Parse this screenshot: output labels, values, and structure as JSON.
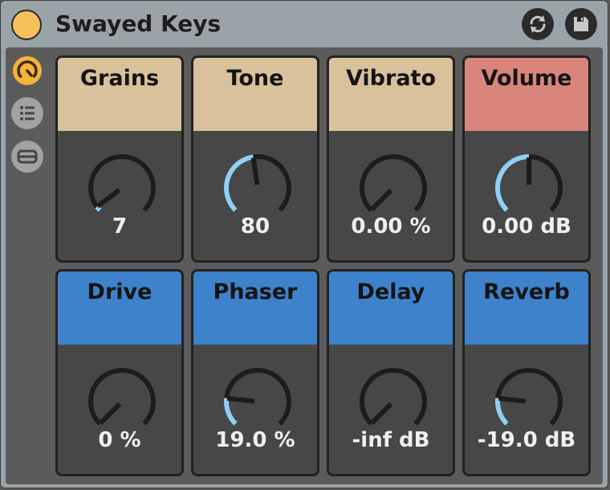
{
  "window": {
    "title": "Swayed Keys",
    "accent_color": "#f7c15a",
    "icons": {
      "power": "power-toggle-icon",
      "refresh": "refresh-icon",
      "save": "save-icon"
    }
  },
  "sidebar": {
    "items": [
      {
        "icon": "macro-knob-icon",
        "active": true
      },
      {
        "icon": "list-icon",
        "active": false
      },
      {
        "icon": "minimize-icon",
        "active": false
      }
    ]
  },
  "colors": {
    "beige": "#d9c19b",
    "red": "#d9857c",
    "blue": "#3d82cb",
    "arc_active": "#8fd0f5",
    "knob_track": "#1c1c1c"
  },
  "knobs": [
    {
      "label": "Grains",
      "value": "7",
      "fraction": 0.03,
      "color": "beige"
    },
    {
      "label": "Tone",
      "value": "80",
      "fraction": 0.47,
      "color": "beige"
    },
    {
      "label": "Vibrato",
      "value": "0.00 %",
      "fraction": 0.0,
      "color": "beige"
    },
    {
      "label": "Volume",
      "value": "0.00 dB",
      "fraction": 0.5,
      "color": "red"
    },
    {
      "label": "Drive",
      "value": "0 %",
      "fraction": 0.0,
      "color": "blue"
    },
    {
      "label": "Phaser",
      "value": "19.0 %",
      "fraction": 0.19,
      "color": "blue"
    },
    {
      "label": "Delay",
      "value": "-inf dB",
      "fraction": 0.0,
      "color": "blue"
    },
    {
      "label": "Reverb",
      "value": "-19.0 dB",
      "fraction": 0.19,
      "color": "blue"
    }
  ]
}
